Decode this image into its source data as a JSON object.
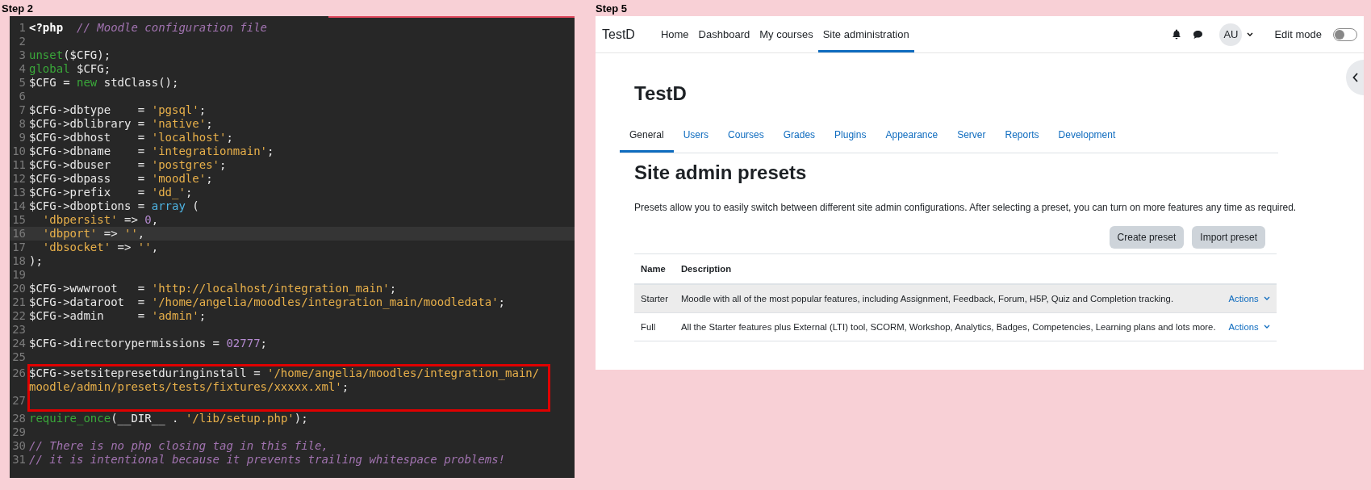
{
  "editor_panel": {
    "label": "Step 2",
    "lines": [
      {
        "number": "1",
        "highlighted": false,
        "boxed": false,
        "tokens": [
          {
            "kind": "tag",
            "text": "<?php"
          },
          {
            "kind": "comment",
            "text": "// Moodle configuration file"
          }
        ]
      },
      {
        "number": "2",
        "highlighted": false,
        "boxed": false
      },
      {
        "number": "3",
        "highlighted": false,
        "boxed": false,
        "tokens": [
          {
            "kind": "keyword",
            "text": "unset"
          },
          {
            "kind": "plain",
            "text": "($CFG);"
          }
        ]
      },
      {
        "number": "4",
        "highlighted": false,
        "boxed": false,
        "tokens": [
          {
            "kind": "keyword",
            "text": "global"
          },
          {
            "kind": "plain",
            "text": " $CFG;"
          }
        ]
      },
      {
        "number": "5",
        "highlighted": false,
        "boxed": false,
        "tokens": [
          {
            "kind": "plain",
            "text": "$CFG = "
          },
          {
            "kind": "keyword",
            "text": "new"
          },
          {
            "kind": "plain",
            "text": " stdClass();"
          }
        ]
      },
      {
        "number": "6",
        "highlighted": false,
        "boxed": false
      },
      {
        "number": "7",
        "highlighted": false,
        "boxed": false,
        "tokens": [
          {
            "kind": "plain",
            "text": "$CFG->dbtype    = "
          },
          {
            "kind": "string",
            "text": "'pgsql'"
          },
          {
            "kind": "plain",
            "text": ";"
          }
        ]
      },
      {
        "number": "8",
        "highlighted": false,
        "boxed": false,
        "tokens": [
          {
            "kind": "plain",
            "text": "$CFG->dblibrary = "
          },
          {
            "kind": "string",
            "text": "'native'"
          },
          {
            "kind": "plain",
            "text": ";"
          }
        ]
      },
      {
        "number": "9",
        "highlighted": false,
        "boxed": false,
        "tokens": [
          {
            "kind": "plain",
            "text": "$CFG->dbhost    = "
          },
          {
            "kind": "string",
            "text": "'localhost'"
          },
          {
            "kind": "plain",
            "text": ";"
          }
        ]
      },
      {
        "number": "10",
        "highlighted": false,
        "boxed": false,
        "tokens": [
          {
            "kind": "plain",
            "text": "$CFG->dbname    = "
          },
          {
            "kind": "string",
            "text": "'integrationmain'"
          },
          {
            "kind": "plain",
            "text": ";"
          }
        ]
      },
      {
        "number": "11",
        "highlighted": false,
        "boxed": false,
        "tokens": [
          {
            "kind": "plain",
            "text": "$CFG->dbuser    = "
          },
          {
            "kind": "string",
            "text": "'postgres'"
          },
          {
            "kind": "plain",
            "text": ";"
          }
        ]
      },
      {
        "number": "12",
        "highlighted": false,
        "boxed": false,
        "tokens": [
          {
            "kind": "plain",
            "text": "$CFG->dbpass    = "
          },
          {
            "kind": "string",
            "text": "'moodle'"
          },
          {
            "kind": "plain",
            "text": ";"
          }
        ]
      },
      {
        "number": "13",
        "highlighted": false,
        "boxed": false,
        "tokens": [
          {
            "kind": "plain",
            "text": "$CFG->prefix    = "
          },
          {
            "kind": "string",
            "text": "'dd_'"
          },
          {
            "kind": "plain",
            "text": ";"
          }
        ]
      },
      {
        "number": "14",
        "highlighted": false,
        "boxed": false,
        "tokens": [
          {
            "kind": "plain",
            "text": "$CFG->dboptions = "
          },
          {
            "kind": "builtin",
            "text": "array"
          },
          {
            "kind": "plain",
            "text": " ("
          }
        ]
      },
      {
        "number": "15",
        "highlighted": false,
        "boxed": false,
        "tokens": [
          {
            "kind": "indent-string",
            "text": "'dbpersist'"
          },
          {
            "kind": "plain",
            "text": " => "
          },
          {
            "kind": "number",
            "text": "0"
          },
          {
            "kind": "plain",
            "text": ","
          }
        ]
      },
      {
        "number": "16",
        "highlighted": true,
        "boxed": false,
        "tokens": [
          {
            "kind": "indent-string",
            "text": "'dbport'"
          },
          {
            "kind": "plain",
            "text": " => "
          },
          {
            "kind": "string",
            "text": "''"
          },
          {
            "kind": "plain",
            "text": ","
          }
        ]
      },
      {
        "number": "17",
        "highlighted": false,
        "boxed": false,
        "tokens": [
          {
            "kind": "indent-string",
            "text": "'dbsocket'"
          },
          {
            "kind": "plain",
            "text": " => "
          },
          {
            "kind": "string",
            "text": "''"
          },
          {
            "kind": "plain",
            "text": ","
          }
        ]
      },
      {
        "number": "18",
        "highlighted": false,
        "boxed": false,
        "tokens": [
          {
            "kind": "plain",
            "text": ");"
          }
        ]
      },
      {
        "number": "19",
        "highlighted": false,
        "boxed": false
      },
      {
        "number": "20",
        "highlighted": false,
        "boxed": false,
        "tokens": [
          {
            "kind": "plain",
            "text": "$CFG->wwwroot   = "
          },
          {
            "kind": "string",
            "text": "'http://localhost/integration_main'"
          },
          {
            "kind": "plain",
            "text": ";"
          }
        ]
      },
      {
        "number": "21",
        "highlighted": false,
        "boxed": false,
        "tokens": [
          {
            "kind": "plain",
            "text": "$CFG->dataroot  = "
          },
          {
            "kind": "string",
            "text": "'/home/angelia/moodles/integration_main/moodledata'"
          },
          {
            "kind": "plain",
            "text": ";"
          }
        ]
      },
      {
        "number": "22",
        "highlighted": false,
        "boxed": false,
        "tokens": [
          {
            "kind": "plain",
            "text": "$CFG->admin     = "
          },
          {
            "kind": "string",
            "text": "'admin'"
          },
          {
            "kind": "plain",
            "text": ";"
          }
        ]
      },
      {
        "number": "23",
        "highlighted": false,
        "boxed": false
      },
      {
        "number": "24",
        "highlighted": false,
        "boxed": false,
        "tokens": [
          {
            "kind": "plain",
            "text": "$CFG->directorypermissions = "
          },
          {
            "kind": "number",
            "text": "02777"
          },
          {
            "kind": "plain",
            "text": ";"
          }
        ]
      },
      {
        "number": "25",
        "highlighted": false,
        "boxed": false
      },
      {
        "number": "26",
        "highlighted": false,
        "boxed": true,
        "tokens": [
          {
            "kind": "plain",
            "text": "$CFG->setsitepresetduringinstall = "
          },
          {
            "kind": "string",
            "text": "'/home/angelia/moodles/integration_main/"
          },
          {
            "kind": "wrap",
            "text": "moodle/admin/presets/tests/fixtures/xxxxx.xml'"
          },
          {
            "kind": "plain",
            "text": ";"
          }
        ]
      },
      {
        "number": "27",
        "highlighted": false,
        "boxed": true
      },
      {
        "number": "28",
        "highlighted": false,
        "boxed": false,
        "tokens": [
          {
            "kind": "keyword",
            "text": "require_once"
          },
          {
            "kind": "plain",
            "text": "(__DIR__ . "
          },
          {
            "kind": "string",
            "text": "'/lib/setup.php'"
          },
          {
            "kind": "plain",
            "text": ");"
          }
        ]
      },
      {
        "number": "29",
        "highlighted": false,
        "boxed": false
      },
      {
        "number": "30",
        "highlighted": false,
        "boxed": false,
        "tokens": [
          {
            "kind": "comment",
            "text": "// There is no php closing tag in this file,"
          }
        ]
      },
      {
        "number": "31",
        "highlighted": false,
        "boxed": false,
        "tokens": [
          {
            "kind": "comment",
            "text": "// it is intentional because it prevents trailing whitespace problems!"
          }
        ]
      }
    ]
  },
  "browser_panel": {
    "label": "Step 5",
    "navbar": {
      "brand": "TestD",
      "items": [
        {
          "label": "Home",
          "selected": false
        },
        {
          "label": "Dashboard",
          "selected": false
        },
        {
          "label": "My courses",
          "selected": false
        },
        {
          "label": "Site administration",
          "selected": true
        }
      ],
      "avatar": "AU",
      "edit_mode": {
        "label": "Edit mode",
        "on": false
      }
    },
    "page_title": "TestD",
    "tabs": [
      {
        "label": "General",
        "selected": true
      },
      {
        "label": "Users",
        "selected": false
      },
      {
        "label": "Courses",
        "selected": false
      },
      {
        "label": "Grades",
        "selected": false
      },
      {
        "label": "Plugins",
        "selected": false
      },
      {
        "label": "Appearance",
        "selected": false
      },
      {
        "label": "Server",
        "selected": false
      },
      {
        "label": "Reports",
        "selected": false
      },
      {
        "label": "Development",
        "selected": false
      }
    ],
    "heading": "Site admin presets",
    "intro": "Presets allow you to easily switch between different site admin configurations. After selecting a preset, you can turn on more features any time as required.",
    "buttons": [
      "Create preset",
      "Import preset"
    ],
    "table": {
      "columns": [
        "Name",
        "Description"
      ],
      "rows": [
        {
          "name": "Starter",
          "description": "Moodle with all of the most popular features, including Assignment, Feedback, Forum, H5P, Quiz and Completion tracking.",
          "action": "Actions",
          "highlighted": true
        },
        {
          "name": "Full",
          "description": "All the Starter features plus External (LTI) tool, SCORM, Workshop, Analytics, Badges, Competencies, Learning plans and lots more.",
          "action": "Actions",
          "highlighted": false
        }
      ]
    }
  }
}
